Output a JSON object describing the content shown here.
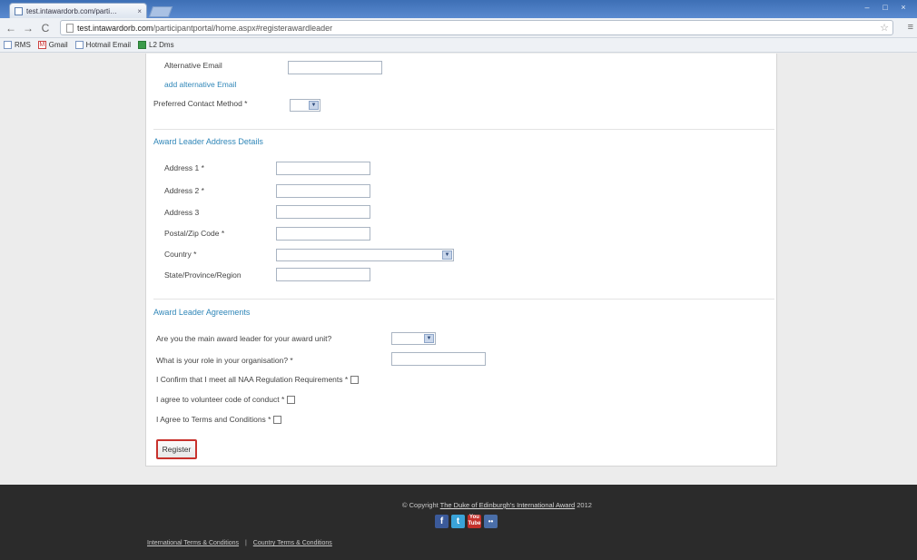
{
  "browser": {
    "tab_title": "test.intawardorb.com/parti…",
    "tab_close": "×",
    "url_domain": "test.intawardorb.com",
    "url_path": "/participantportal/home.aspx#registerawardleader",
    "bookmarks": [
      {
        "label": "RMS"
      },
      {
        "label": "Gmail"
      },
      {
        "label": "Hotmail Email"
      },
      {
        "label": "L2 Dms"
      }
    ]
  },
  "form": {
    "alt_email_label": "Alternative Email",
    "add_alt_email_link": "add alternative Email",
    "preferred_contact_label": "Preferred Contact Method *",
    "address_section_title": "Award Leader Address Details",
    "address1_label": "Address 1 *",
    "address2_label": "Address 2 *",
    "address3_label": "Address 3",
    "postal_label": "Postal/Zip Code *",
    "country_label": "Country *",
    "state_label": "State/Province/Region",
    "agreements_section_title": "Award Leader Agreements",
    "main_leader_label": "Are you the main award leader for your award unit?",
    "role_label": "What is your role in your organisation? *",
    "naa_label": "I Confirm that I meet all NAA Regulation Requirements *",
    "volunteer_label": "I agree to volunteer code of conduct *",
    "terms_label": "I Agree to Terms and Conditions *",
    "register_label": "Register"
  },
  "footer": {
    "copyright_prefix": "© Copyright",
    "copyright_org": "The Duke of Edinburgh's International Award",
    "copyright_year": "2012",
    "social": [
      {
        "name": "facebook",
        "glyph": "f"
      },
      {
        "name": "twitter",
        "glyph": "t"
      },
      {
        "name": "youtube",
        "glyph": "You Tube"
      },
      {
        "name": "flickr",
        "glyph": "••"
      }
    ],
    "link_international": "International Terms & Conditions",
    "link_separator": "|",
    "link_country": "Country Terms & Conditions"
  }
}
